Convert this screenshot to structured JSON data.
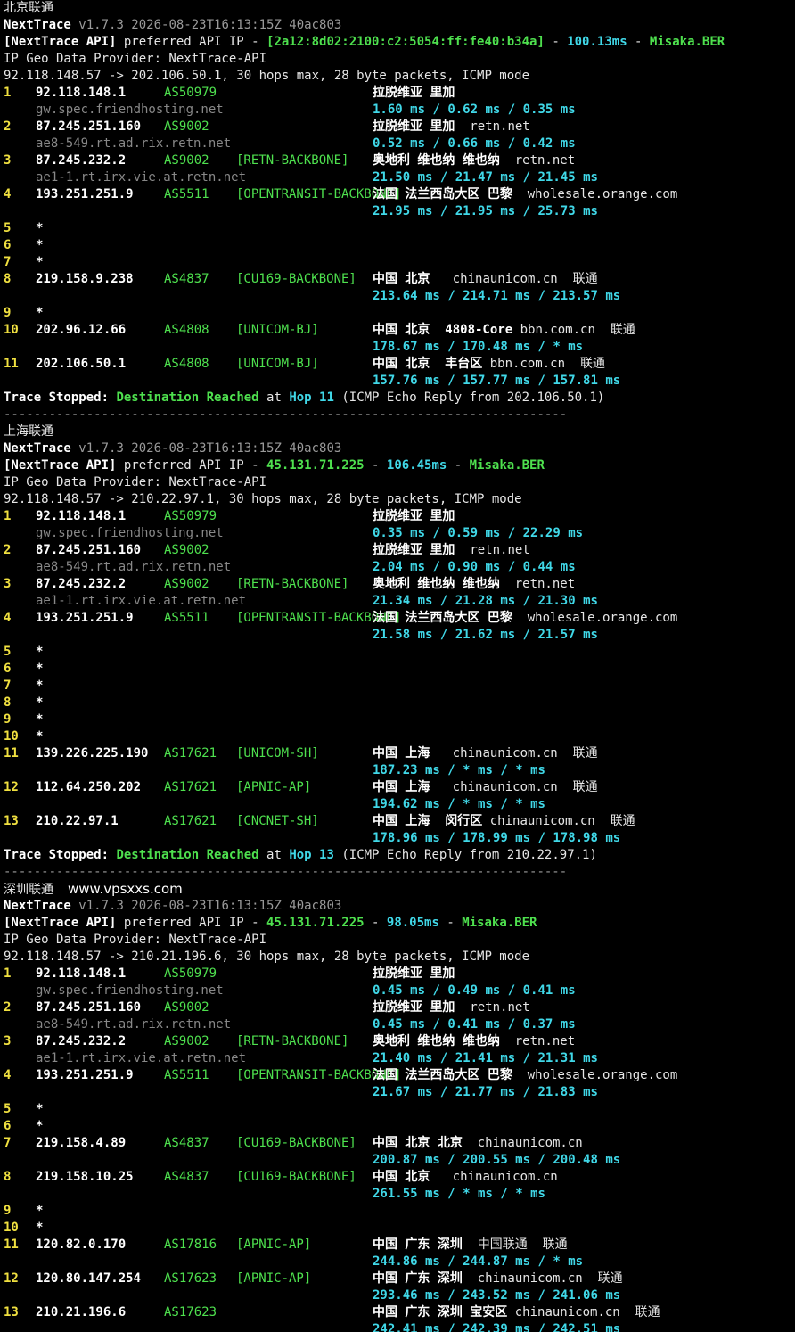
{
  "watermark": "www.vpsxxs.com",
  "traces": [
    {
      "section_title": "北京联通",
      "app_name": "NextTrace",
      "version_line": "v1.7.3 2026-08-23T16:13:15Z 40ac803",
      "api_label": "[NextTrace API]",
      "api_text": " preferred API IP - ",
      "api_ip": "[2a12:8d02:2100:c2:5054:ff:fe40:b34a]",
      "api_dash1": " - ",
      "api_latency": "100.13ms",
      "api_dash2": " - ",
      "api_node": "Misaka.BER",
      "geo_provider": "IP Geo Data Provider: NextTrace-API",
      "target_line": "92.118.148.57 -> 202.106.50.1, 30 hops max, 28 byte packets, ICMP mode",
      "hops": [
        {
          "n": "1",
          "ip": "92.118.148.1",
          "as": "AS50979",
          "tag": "",
          "geo": "拉脱维亚 里加",
          "extra": "",
          "host": "gw.spec.friendhosting.net",
          "rtt": [
            "1.60",
            "0.62",
            "0.35"
          ]
        },
        {
          "n": "2",
          "ip": "87.245.251.160",
          "as": "AS9002",
          "tag": "",
          "geo": "拉脱维亚 里加",
          "extra": "  retn.net",
          "host": "ae8-549.rt.ad.rix.retn.net",
          "rtt": [
            "0.52",
            "0.66",
            "0.42"
          ]
        },
        {
          "n": "3",
          "ip": "87.245.232.2",
          "as": "AS9002",
          "tag": "[RETN-BACKBONE]",
          "geo": "奥地利 维也纳 维也纳",
          "extra": "  retn.net",
          "host": "ae1-1.rt.irx.vie.at.retn.net",
          "rtt": [
            "21.50",
            "21.47",
            "21.45"
          ]
        },
        {
          "n": "4",
          "ip": "193.251.251.9",
          "as": "AS5511",
          "tag": "[OPENTRANSIT-BACKBONE]",
          "geo": "法国 法兰西岛大区 巴黎",
          "extra": "  wholesale.orange.com",
          "host": "",
          "rtt": [
            "21.95",
            "21.95",
            "25.73"
          ]
        },
        {
          "n": "5",
          "star": true
        },
        {
          "n": "6",
          "star": true
        },
        {
          "n": "7",
          "star": true
        },
        {
          "n": "8",
          "ip": "219.158.9.238",
          "as": "AS4837",
          "tag": "[CU169-BACKBONE]",
          "geo": "中国 北京",
          "extra": "   chinaunicom.cn  联通",
          "host": "",
          "rtt": [
            "213.64",
            "214.71",
            "213.57"
          ]
        },
        {
          "n": "9",
          "star": true
        },
        {
          "n": "10",
          "ip": "202.96.12.66",
          "as": "AS4808",
          "tag": "[UNICOM-BJ]",
          "geo": "中国 北京  4808-Core",
          "extra": " bbn.com.cn  联通",
          "host": "",
          "rtt": [
            "178.67",
            "170.48",
            "*"
          ]
        },
        {
          "n": "11",
          "ip": "202.106.50.1",
          "as": "AS4808",
          "tag": "[UNICOM-BJ]",
          "geo": "中国 北京  丰台区",
          "extra": " bbn.com.cn  联通",
          "host": "",
          "rtt": [
            "157.76",
            "157.77",
            "157.81"
          ]
        }
      ],
      "stop_label": "Trace Stopped:",
      "stop_reached": "Destination Reached",
      "stop_at": " at ",
      "stop_hop": "Hop 11",
      "stop_reply": " (ICMP Echo Reply from 202.106.50.1)"
    },
    {
      "section_title": "上海联通",
      "app_name": "NextTrace",
      "version_line": "v1.7.3 2026-08-23T16:13:15Z 40ac803",
      "api_label": "[NextTrace API]",
      "api_text": " preferred API IP - ",
      "api_ip": "45.131.71.225",
      "api_dash1": " - ",
      "api_latency": "106.45ms",
      "api_dash2": " - ",
      "api_node": "Misaka.BER",
      "geo_provider": "IP Geo Data Provider: NextTrace-API",
      "target_line": "92.118.148.57 -> 210.22.97.1, 30 hops max, 28 byte packets, ICMP mode",
      "hops": [
        {
          "n": "1",
          "ip": "92.118.148.1",
          "as": "AS50979",
          "tag": "",
          "geo": "拉脱维亚 里加",
          "extra": "",
          "host": "gw.spec.friendhosting.net",
          "rtt": [
            "0.35",
            "0.59",
            "22.29"
          ]
        },
        {
          "n": "2",
          "ip": "87.245.251.160",
          "as": "AS9002",
          "tag": "",
          "geo": "拉脱维亚 里加",
          "extra": "  retn.net",
          "host": "ae8-549.rt.ad.rix.retn.net",
          "rtt": [
            "2.04",
            "0.90",
            "0.44"
          ]
        },
        {
          "n": "3",
          "ip": "87.245.232.2",
          "as": "AS9002",
          "tag": "[RETN-BACKBONE]",
          "geo": "奥地利 维也纳 维也纳",
          "extra": "  retn.net",
          "host": "ae1-1.rt.irx.vie.at.retn.net",
          "rtt": [
            "21.34",
            "21.28",
            "21.30"
          ]
        },
        {
          "n": "4",
          "ip": "193.251.251.9",
          "as": "AS5511",
          "tag": "[OPENTRANSIT-BACKBONE]",
          "geo": "法国 法兰西岛大区 巴黎",
          "extra": "  wholesale.orange.com",
          "host": "",
          "rtt": [
            "21.58",
            "21.62",
            "21.57"
          ]
        },
        {
          "n": "5",
          "star": true
        },
        {
          "n": "6",
          "star": true
        },
        {
          "n": "7",
          "star": true
        },
        {
          "n": "8",
          "star": true
        },
        {
          "n": "9",
          "star": true
        },
        {
          "n": "10",
          "star": true
        },
        {
          "n": "11",
          "ip": "139.226.225.190",
          "as": "AS17621",
          "tag": "[UNICOM-SH]",
          "geo": "中国 上海",
          "extra": "   chinaunicom.cn  联通",
          "host": "",
          "rtt": [
            "187.23",
            "*",
            "*"
          ]
        },
        {
          "n": "12",
          "ip": "112.64.250.202",
          "as": "AS17621",
          "tag": "[APNIC-AP]",
          "geo": "中国 上海",
          "extra": "   chinaunicom.cn  联通",
          "host": "",
          "rtt": [
            "194.62",
            "*",
            "*"
          ]
        },
        {
          "n": "13",
          "ip": "210.22.97.1",
          "as": "AS17621",
          "tag": "[CNCNET-SH]",
          "geo": "中国 上海  闵行区",
          "extra": " chinaunicom.cn  联通",
          "host": "",
          "rtt": [
            "178.96",
            "178.99",
            "178.98"
          ]
        }
      ],
      "stop_label": "Trace Stopped:",
      "stop_reached": "Destination Reached",
      "stop_at": " at ",
      "stop_hop": "Hop 13",
      "stop_reply": " (ICMP Echo Reply from 210.22.97.1)"
    },
    {
      "section_title": "深圳联通",
      "app_name": "NextTrace",
      "version_line": "v1.7.3 2026-08-23T16:13:15Z 40ac803",
      "api_label": "[NextTrace API]",
      "api_text": " preferred API IP - ",
      "api_ip": "45.131.71.225",
      "api_dash1": " - ",
      "api_latency": "98.05ms",
      "api_dash2": " - ",
      "api_node": "Misaka.BER",
      "geo_provider": "IP Geo Data Provider: NextTrace-API",
      "target_line": "92.118.148.57 -> 210.21.196.6, 30 hops max, 28 byte packets, ICMP mode",
      "hops": [
        {
          "n": "1",
          "ip": "92.118.148.1",
          "as": "AS50979",
          "tag": "",
          "geo": "拉脱维亚 里加",
          "extra": "",
          "host": "gw.spec.friendhosting.net",
          "rtt": [
            "0.45",
            "0.49",
            "0.41"
          ]
        },
        {
          "n": "2",
          "ip": "87.245.251.160",
          "as": "AS9002",
          "tag": "",
          "geo": "拉脱维亚 里加",
          "extra": "  retn.net",
          "host": "ae8-549.rt.ad.rix.retn.net",
          "rtt": [
            "0.45",
            "0.41",
            "0.37"
          ]
        },
        {
          "n": "3",
          "ip": "87.245.232.2",
          "as": "AS9002",
          "tag": "[RETN-BACKBONE]",
          "geo": "奥地利 维也纳 维也纳",
          "extra": "  retn.net",
          "host": "ae1-1.rt.irx.vie.at.retn.net",
          "rtt": [
            "21.40",
            "21.41",
            "21.31"
          ]
        },
        {
          "n": "4",
          "ip": "193.251.251.9",
          "as": "AS5511",
          "tag": "[OPENTRANSIT-BACKBONE]",
          "geo": "法国 法兰西岛大区 巴黎",
          "extra": "  wholesale.orange.com",
          "host": "",
          "rtt": [
            "21.67",
            "21.77",
            "21.83"
          ]
        },
        {
          "n": "5",
          "star": true
        },
        {
          "n": "6",
          "star": true
        },
        {
          "n": "7",
          "ip": "219.158.4.89",
          "as": "AS4837",
          "tag": "[CU169-BACKBONE]",
          "geo": "中国 北京 北京",
          "extra": "  chinaunicom.cn",
          "host": "",
          "rtt": [
            "200.87",
            "200.55",
            "200.48"
          ]
        },
        {
          "n": "8",
          "ip": "219.158.10.25",
          "as": "AS4837",
          "tag": "[CU169-BACKBONE]",
          "geo": "中国 北京",
          "extra": "   chinaunicom.cn",
          "host": "",
          "rtt": [
            "261.55",
            "*",
            "*"
          ]
        },
        {
          "n": "9",
          "star": true
        },
        {
          "n": "10",
          "star": true
        },
        {
          "n": "11",
          "ip": "120.82.0.170",
          "as": "AS17816",
          "tag": "[APNIC-AP]",
          "geo": "中国 广东 深圳",
          "extra": "  中国联通  联通",
          "host": "",
          "rtt": [
            "244.86",
            "244.87",
            "*"
          ]
        },
        {
          "n": "12",
          "ip": "120.80.147.254",
          "as": "AS17623",
          "tag": "[APNIC-AP]",
          "geo": "中国 广东 深圳",
          "extra": "  chinaunicom.cn  联通",
          "host": "",
          "rtt": [
            "293.46",
            "243.52",
            "241.06"
          ]
        },
        {
          "n": "13",
          "ip": "210.21.196.6",
          "as": "AS17623",
          "tag": "",
          "geo": "中国 广东 深圳 宝安区",
          "extra": " chinaunicom.cn  联通",
          "host": "",
          "rtt": [
            "242.41",
            "242.39",
            "242.51"
          ]
        }
      ]
    }
  ],
  "separator": "---------------------------------------------------------------------------",
  "colors": {
    "background": "#000000",
    "hop_number": "#f0e040",
    "asn": "#4ee04e",
    "rtt": "#40d8e8",
    "hostname": "#888888"
  }
}
